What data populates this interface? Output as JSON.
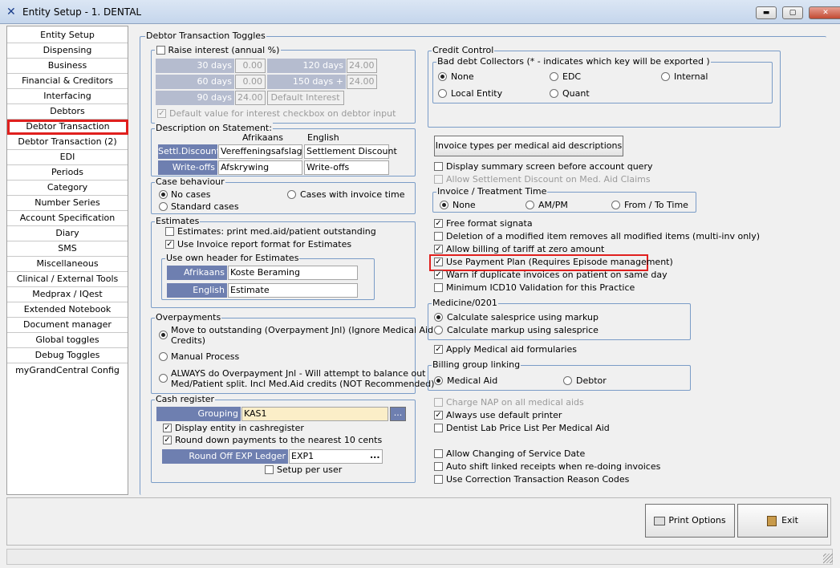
{
  "window": {
    "title": "Entity Setup - 1. DENTAL",
    "min": "▬",
    "max": "▢",
    "close": "✕"
  },
  "nav": [
    "Entity Setup",
    "Dispensing",
    "Business",
    "Financial & Creditors",
    "Interfacing",
    "Debtors",
    "Debtor Transaction",
    "Debtor Transaction (2)",
    "EDI",
    "Periods",
    "Category",
    "Number Series",
    "Account Specification",
    "Diary",
    "SMS",
    "Miscellaneous",
    "Clinical / External Tools",
    "Medprax / IQest",
    "Extended Notebook",
    "Document manager",
    "Global toggles",
    "Debug Toggles",
    "myGrandCentral Config"
  ],
  "main": {
    "title": "Debtor Transaction Toggles"
  },
  "interest": {
    "raise_label": "Raise interest (annual %)",
    "d30": "30 days",
    "v30": "0.00",
    "d60": "60 days",
    "v60": "0.00",
    "d90": "90 days",
    "v90": "24.00",
    "d120": "120 days",
    "v120": "24.00",
    "d150": "150 days +",
    "v150": "24.00",
    "default_interest": "Default Interest",
    "default_cb": "Default value for interest checkbox on debtor input"
  },
  "statement": {
    "title": "Description on Statement:",
    "col_af": "Afrikaans",
    "col_en": "English",
    "r1": "Settl.Discount",
    "r1_af": "Vereffeningsafslag",
    "r1_en": "Settlement Discount",
    "r2": "Write-offs",
    "r2_af": "Afskrywing",
    "r2_en": "Write-offs"
  },
  "case": {
    "title": "Case behaviour",
    "no_cases": "No cases",
    "cases_time": "Cases with invoice time",
    "standard": "Standard cases"
  },
  "est": {
    "title": "Estimates",
    "print": "Estimates: print med.aid/patient outstanding",
    "use_invoice": "Use Invoice report format for Estimates",
    "header_title": "Use own header for Estimates",
    "af": "Afrikaans",
    "af_val": "Koste Beraming",
    "en": "English",
    "en_val": "Estimate"
  },
  "over": {
    "title": "Overpayments",
    "opt1": "Move to outstanding (Overpayment Jnl) (Ignore Medical Aid",
    "opt1b": "Credits)",
    "opt2": "Manual Process",
    "opt3": "ALWAYS do Overpayment Jnl  - Will attempt to balance out",
    "opt3b": "Med/Patient split. Incl Med.Aid credits (NOT Recommended)"
  },
  "cash": {
    "title": "Cash register",
    "grouping": "Grouping",
    "grouping_val": "KAS1",
    "ellipsis": "...",
    "display": "Display entity in cashregister",
    "round": "Round down payments to the nearest 10 cents",
    "ledger": "Round Off EXP Ledger",
    "ledger_val": "EXP1",
    "per_user": "Setup per user"
  },
  "credit": {
    "title": "Credit Control",
    "bad_title": "Bad debt Collectors (* - indicates which key will be exported )",
    "none": "None",
    "edc": "EDC",
    "internal": "Internal",
    "local": "Local Entity",
    "quant": "Quant"
  },
  "right": {
    "inv_types_btn": "Invoice types per medical aid descriptions",
    "summary": "Display summary screen before account query",
    "allow_settle": "Allow Settlement Discount on Med. Aid Claims",
    "it_title": "Invoice / Treatment Time",
    "it_none": "None",
    "it_ampm": "AM/PM",
    "it_from": "From / To Time",
    "free": "Free format signata",
    "deletion": "Deletion of a modified item removes all modified items (multi-inv only)",
    "allow_zero": "Allow billing of tariff at zero amount",
    "payment_plan": "Use Payment Plan (Requires Episode management)",
    "warn": "Warn if duplicate invoices on patient on same day",
    "icd10": "Minimum ICD10 Validation for this Practice",
    "med_title": "Medicine/0201",
    "markup1": "Calculate salesprice using markup",
    "markup2": "Calculate markup using salesprice",
    "formularies": "Apply Medical aid formularies",
    "bg_title": "Billing group linking",
    "bg_med": "Medical Aid",
    "bg_debtor": "Debtor",
    "nap": "Charge NAP on all medical aids",
    "printer": "Always use default printer",
    "dentist": "Dentist Lab Price List Per Medical Aid",
    "service_date": "Allow Changing of Service Date",
    "auto_shift": "Auto shift linked receipts when re-doing invoices",
    "correction": "Use Correction Transaction Reason Codes"
  },
  "footer": {
    "print": "Print Options",
    "exit": "Exit"
  }
}
